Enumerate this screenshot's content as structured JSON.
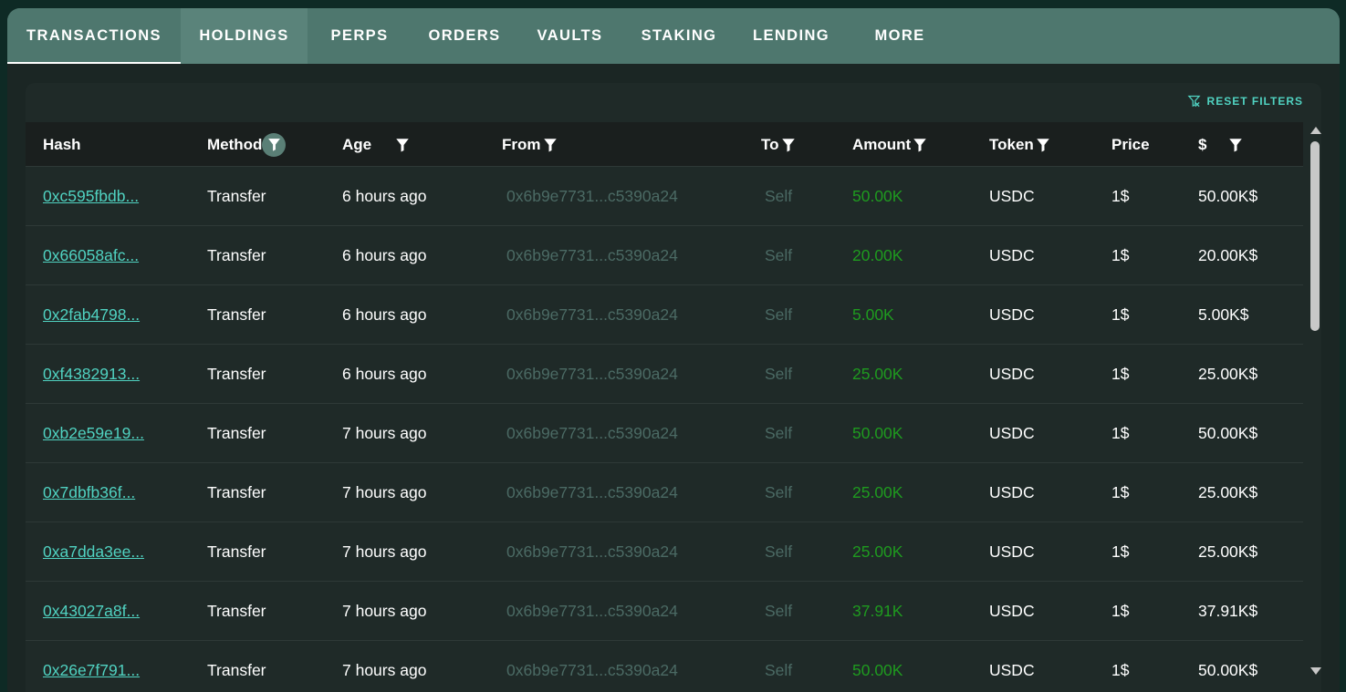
{
  "tabs": [
    {
      "label": "TRANSACTIONS",
      "width": 190,
      "active": true
    },
    {
      "label": "HOLDINGS",
      "width": 139,
      "hover": true
    },
    {
      "label": "PERPS",
      "width": 114
    },
    {
      "label": "ORDERS",
      "width": 116
    },
    {
      "label": "VAULTS",
      "width": 115
    },
    {
      "label": "STAKING",
      "width": 124
    },
    {
      "label": "LENDING",
      "width": 122
    },
    {
      "label": "MORE",
      "width": 116
    }
  ],
  "toolbar": {
    "reset_label": "RESET FILTERS"
  },
  "columns": {
    "hash": "Hash",
    "method": "Method",
    "age": "Age",
    "from": "From",
    "to": "To",
    "amount": "Amount",
    "token": "Token",
    "price": "Price",
    "dollar": "$"
  },
  "rows": [
    {
      "hash": "0xc595fbdb...",
      "method": "Transfer",
      "age": "6 hours ago",
      "from": "0x6b9e7731...c5390a24",
      "to": "Self",
      "amount": "50.00K",
      "token": "USDC",
      "price": "1$",
      "value": "50.00K$"
    },
    {
      "hash": "0x66058afc...",
      "method": "Transfer",
      "age": "6 hours ago",
      "from": "0x6b9e7731...c5390a24",
      "to": "Self",
      "amount": "20.00K",
      "token": "USDC",
      "price": "1$",
      "value": "20.00K$"
    },
    {
      "hash": "0x2fab4798...",
      "method": "Transfer",
      "age": "6 hours ago",
      "from": "0x6b9e7731...c5390a24",
      "to": "Self",
      "amount": "5.00K",
      "token": "USDC",
      "price": "1$",
      "value": "5.00K$"
    },
    {
      "hash": "0xf4382913...",
      "method": "Transfer",
      "age": "6 hours ago",
      "from": "0x6b9e7731...c5390a24",
      "to": "Self",
      "amount": "25.00K",
      "token": "USDC",
      "price": "1$",
      "value": "25.00K$"
    },
    {
      "hash": "0xb2e59e19...",
      "method": "Transfer",
      "age": "7 hours ago",
      "from": "0x6b9e7731...c5390a24",
      "to": "Self",
      "amount": "50.00K",
      "token": "USDC",
      "price": "1$",
      "value": "50.00K$"
    },
    {
      "hash": "0x7dbfb36f...",
      "method": "Transfer",
      "age": "7 hours ago",
      "from": "0x6b9e7731...c5390a24",
      "to": "Self",
      "amount": "25.00K",
      "token": "USDC",
      "price": "1$",
      "value": "25.00K$"
    },
    {
      "hash": "0xa7dda3ee...",
      "method": "Transfer",
      "age": "7 hours ago",
      "from": "0x6b9e7731...c5390a24",
      "to": "Self",
      "amount": "25.00K",
      "token": "USDC",
      "price": "1$",
      "value": "25.00K$"
    },
    {
      "hash": "0x43027a8f...",
      "method": "Transfer",
      "age": "7 hours ago",
      "from": "0x6b9e7731...c5390a24",
      "to": "Self",
      "amount": "37.91K",
      "token": "USDC",
      "price": "1$",
      "value": "37.91K$"
    },
    {
      "hash": "0x26e7f791...",
      "method": "Transfer",
      "age": "7 hours ago",
      "from": "0x6b9e7731...c5390a24",
      "to": "Self",
      "amount": "50.00K",
      "token": "USDC",
      "price": "1$",
      "value": "50.00K$"
    }
  ],
  "colors": {
    "accent": "#50d2c1",
    "amount_green": "#1f9b1f",
    "tab_bar": "#4e776e"
  },
  "icons": {
    "filter": "filter-icon",
    "reset": "filter-off-icon",
    "scroll_up": "chevron-up-icon",
    "scroll_down": "chevron-down-icon"
  }
}
